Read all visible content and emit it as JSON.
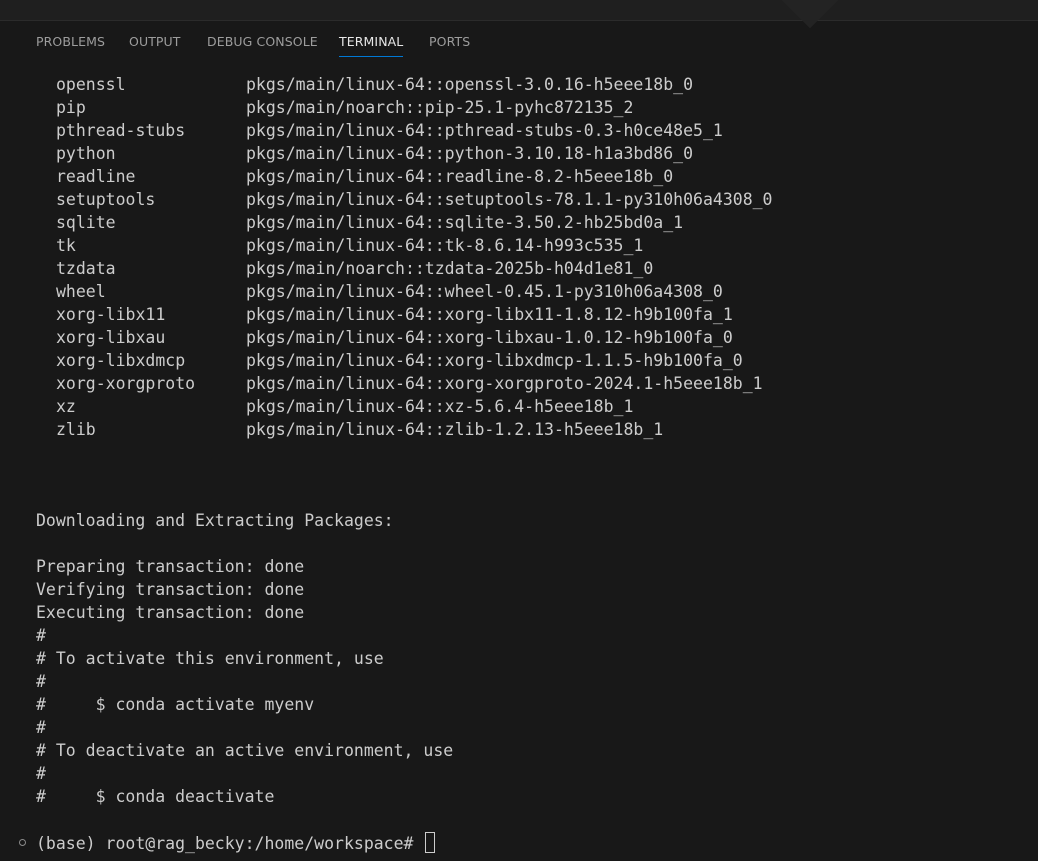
{
  "panel": {
    "tabs": [
      {
        "label": "PROBLEMS"
      },
      {
        "label": "OUTPUT"
      },
      {
        "label": "DEBUG CONSOLE"
      },
      {
        "label": "TERMINAL"
      },
      {
        "label": "PORTS"
      }
    ],
    "active_tab": "TERMINAL"
  },
  "terminal": {
    "packages": [
      {
        "name": "openssl",
        "source": "pkgs/main/linux-64::openssl-3.0.16-h5eee18b_0"
      },
      {
        "name": "pip",
        "source": "pkgs/main/noarch::pip-25.1-pyhc872135_2"
      },
      {
        "name": "pthread-stubs",
        "source": "pkgs/main/linux-64::pthread-stubs-0.3-h0ce48e5_1"
      },
      {
        "name": "python",
        "source": "pkgs/main/linux-64::python-3.10.18-h1a3bd86_0"
      },
      {
        "name": "readline",
        "source": "pkgs/main/linux-64::readline-8.2-h5eee18b_0"
      },
      {
        "name": "setuptools",
        "source": "pkgs/main/linux-64::setuptools-78.1.1-py310h06a4308_0"
      },
      {
        "name": "sqlite",
        "source": "pkgs/main/linux-64::sqlite-3.50.2-hb25bd0a_1"
      },
      {
        "name": "tk",
        "source": "pkgs/main/linux-64::tk-8.6.14-h993c535_1"
      },
      {
        "name": "tzdata",
        "source": "pkgs/main/noarch::tzdata-2025b-h04d1e81_0"
      },
      {
        "name": "wheel",
        "source": "pkgs/main/linux-64::wheel-0.45.1-py310h06a4308_0"
      },
      {
        "name": "xorg-libx11",
        "source": "pkgs/main/linux-64::xorg-libx11-1.8.12-h9b100fa_1"
      },
      {
        "name": "xorg-libxau",
        "source": "pkgs/main/linux-64::xorg-libxau-1.0.12-h9b100fa_0"
      },
      {
        "name": "xorg-libxdmcp",
        "source": "pkgs/main/linux-64::xorg-libxdmcp-1.1.5-h9b100fa_0"
      },
      {
        "name": "xorg-xorgproto",
        "source": "pkgs/main/linux-64::xorg-xorgproto-2024.1-h5eee18b_1"
      },
      {
        "name": "xz",
        "source": "pkgs/main/linux-64::xz-5.6.4-h5eee18b_1"
      },
      {
        "name": "zlib",
        "source": "pkgs/main/linux-64::zlib-1.2.13-h5eee18b_1"
      }
    ],
    "lines": [
      "Downloading and Extracting Packages:",
      "",
      "Preparing transaction: done",
      "Verifying transaction: done",
      "Executing transaction: done",
      "#",
      "# To activate this environment, use",
      "#",
      "#     $ conda activate myenv",
      "#",
      "# To deactivate an active environment, use",
      "#",
      "#     $ conda deactivate"
    ],
    "prompt": "(base) root@rag_becky:/home/workspace# "
  },
  "colors": {
    "background": "#181818",
    "text": "#cccccc",
    "active_tab_underline": "#0078d4"
  }
}
